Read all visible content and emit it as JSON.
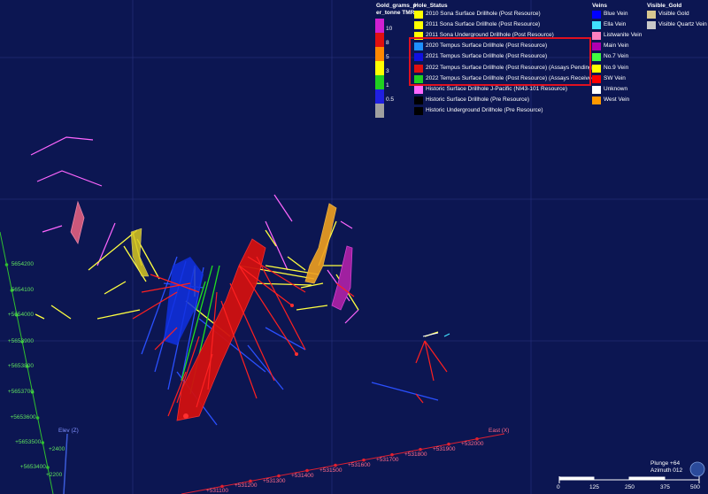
{
  "legends": {
    "gold": {
      "title_line1": "Gold_grams_p",
      "title_line2": "er_tonne TMR",
      "bins": [
        {
          "label": "10",
          "color": "#d020d0"
        },
        {
          "label": "8",
          "color": "#e01010"
        },
        {
          "label": "5",
          "color": "#ff8800"
        },
        {
          "label": "3",
          "color": "#ffff00"
        },
        {
          "label": "1",
          "color": "#20d020"
        },
        {
          "label": "0.5",
          "color": "#2020e0"
        },
        {
          "label": "",
          "color": "#a0a0a0"
        }
      ]
    },
    "hole_status": {
      "title": "Hole_Status",
      "items": [
        {
          "label": "2010 Sona Surface Drillhole (Post Resource)",
          "color": "#ffff00"
        },
        {
          "label": "2011 Sona Surface Drillhole (Post Resource)",
          "color": "#ffff00"
        },
        {
          "label": "2011 Sona Underground Drillhole (Post Resource)",
          "color": "#ffff00"
        },
        {
          "label": "2020 Tempus Surface Drillhole (Post Resource)",
          "color": "#1e90ff"
        },
        {
          "label": "2021 Tempus Surface Drillhole (Post Resource)",
          "color": "#1010e0"
        },
        {
          "label": "2022 Tempus Surface Drillhole (Post Resource) (Assays Pending)",
          "color": "#e01010"
        },
        {
          "label": "2022 Tempus Surface Drillhole (Post Resource) (Assays Received)",
          "color": "#20d020"
        },
        {
          "label": "Historic Surface Drillhole J-Pacific (NI43-101 Resource)",
          "color": "#ff66ff"
        },
        {
          "label": "Historic Surface Drillhole (Pre Resource)",
          "color": "#000000"
        },
        {
          "label": "Historic Underground Drillhole (Pre Resource)",
          "color": "#000000"
        }
      ]
    },
    "veins": {
      "title": "Veins",
      "items": [
        {
          "label": "Blue Vein",
          "color": "#0000ff"
        },
        {
          "label": "Ella Vein",
          "color": "#40e0ff"
        },
        {
          "label": "Listwanite Vein",
          "color": "#ff80c0"
        },
        {
          "label": "Main Vein",
          "color": "#b000b0"
        },
        {
          "label": "No.7 Vein",
          "color": "#40ff40"
        },
        {
          "label": "No.9 Vein",
          "color": "#ffff00"
        },
        {
          "label": "SW Vein",
          "color": "#ff0000"
        },
        {
          "label": "Unknown",
          "color": "#ffffff"
        },
        {
          "label": "West Vein",
          "color": "#ff9900"
        }
      ]
    },
    "visible_gold": {
      "title": "Visible_Gold",
      "items": [
        {
          "label": "Visible Gold",
          "color": "#d8c890"
        },
        {
          "label": "Visible Quartz Vein",
          "color": "#c8c8c8"
        }
      ]
    }
  },
  "axes": {
    "north_labels": [
      "5654200",
      "5654100",
      "+5654000",
      "+5653900",
      "+5653800",
      "+5653700",
      "+5653600",
      "+5653500",
      "+5653400"
    ],
    "east_labels": [
      "+531100",
      "+531200",
      "+531300",
      "+531400",
      "+531500",
      "+531600",
      "+531700",
      "+531800",
      "+531900",
      "+532000"
    ],
    "east_axis_label": "East (X)",
    "elev_axis_label": "Elev (Z)",
    "elev_labels": [
      "+2400",
      "+2200"
    ]
  },
  "status": {
    "plunge": "Plunge +64",
    "azimuth": "Azimuth 012"
  },
  "scale_bar": {
    "labels": [
      "0",
      "125",
      "250",
      "375",
      "500"
    ]
  },
  "colors": {
    "background": "#0c1652",
    "grid": "#2a3580",
    "highlight_box": "#e01020"
  }
}
